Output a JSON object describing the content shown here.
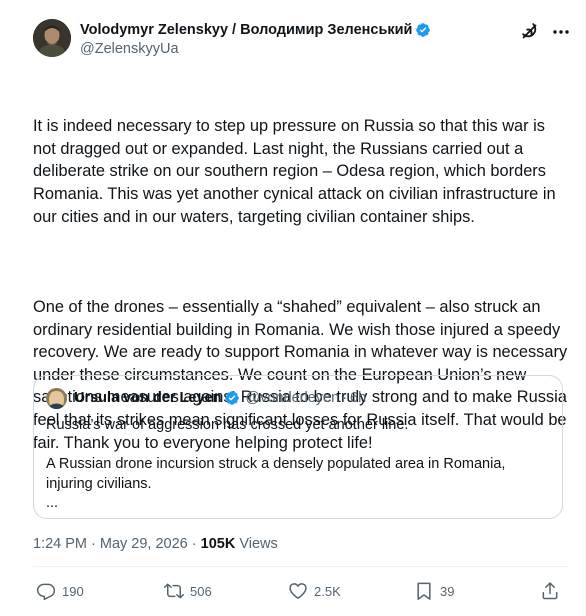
{
  "author": {
    "display_name": "Volodymyr Zelenskyy / Володимир Зеленський",
    "handle": "@ZelenskyyUa",
    "verified_badge_color": "#1d9bf0"
  },
  "icons": {
    "grok": "grok-icon",
    "more": "more-icon",
    "verified": "verified-badge-icon",
    "reply": "reply-icon",
    "repost": "repost-icon",
    "like": "heart-icon",
    "bookmark": "bookmark-icon",
    "share": "share-icon"
  },
  "tweet": {
    "paragraphs": [
      "It is indeed necessary to step up pressure on Russia so that this war is not dragged out or expanded. Last night, the Russians carried out a deliberate strike on our southern region – Odesa region, which borders Romania. This was yet another cynical attack on civilian infrastructure in our cities and in our waters, targeting civilian container ships.",
      "One of the drones – essentially a “shahed” equivalent – also struck an ordinary residential building in Romania. We wish those injured a speedy recovery. We are ready to support Romania in whatever way is necessary under these circumstances. We count on the European Union’s new sanctions measures against Russia to be truly strong and to make Russia feel that its strikes mean significant losses for Russia itself. That would be fair. Thank you to everyone helping protect life!"
    ]
  },
  "quote": {
    "display_name": "Ursula von der Leyen",
    "handle": "@vonderleyen",
    "separator": "·",
    "time": "6h",
    "paragraphs": [
      "Russia’s war of aggression has crossed yet another line.",
      "A Russian drone incursion struck a densely populated area in Romania, injuring civilians.\n..."
    ]
  },
  "meta": {
    "timestamp": "1:24 PM · May 29, 2026 · ",
    "views_count": "105K",
    "views_label": " Views"
  },
  "actions": {
    "replies": "190",
    "reposts": "506",
    "likes": "2.5K",
    "bookmarks": "39"
  },
  "colors": {
    "text": "#0f1419",
    "secondary": "#536471",
    "border": "#cfd9de",
    "accent": "#1d9bf0"
  }
}
